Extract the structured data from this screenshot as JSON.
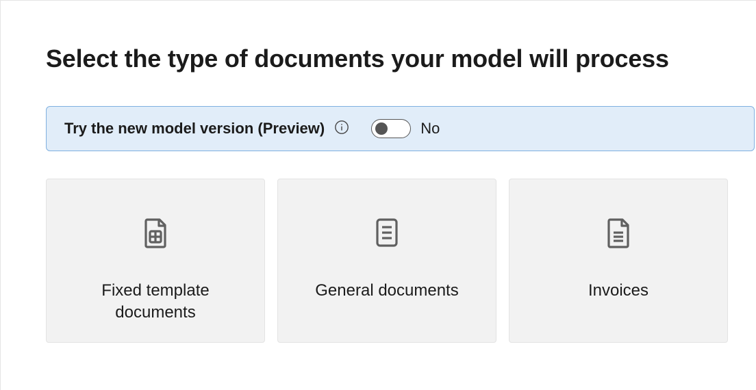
{
  "page": {
    "title": "Select the type of documents your model will process"
  },
  "banner": {
    "label": "Try the new model version (Preview)",
    "toggle_state": "No"
  },
  "cards": [
    {
      "label": "Fixed template documents"
    },
    {
      "label": "General documents"
    },
    {
      "label": "Invoices"
    }
  ]
}
